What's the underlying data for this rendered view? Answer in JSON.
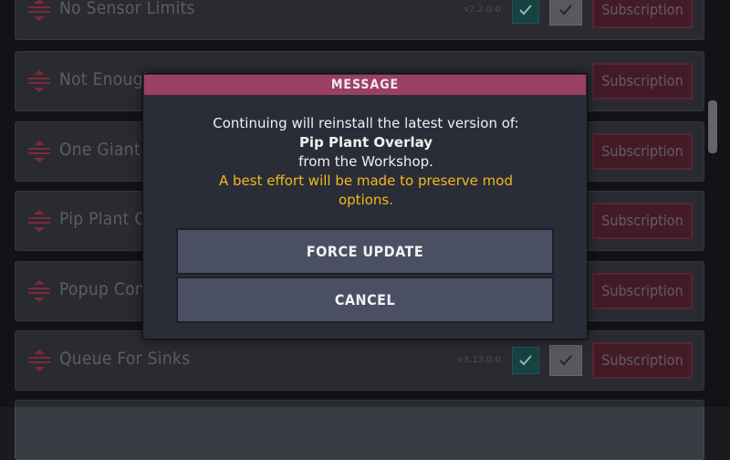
{
  "mods": [
    {
      "name": "No Sensor Limits",
      "version": "v2.2.0.0",
      "subscription_label": "Subscription"
    },
    {
      "name": "Not Enough",
      "version": "",
      "subscription_label": "Subscription"
    },
    {
      "name": "One Giant L",
      "version": "",
      "subscription_label": "Subscription"
    },
    {
      "name": "Pip Plant Ov",
      "version": "",
      "subscription_label": "Subscription"
    },
    {
      "name": "Popup Contr",
      "version": "",
      "subscription_label": "Subscription"
    },
    {
      "name": "Queue For Sinks",
      "version": "v3.13.0.0",
      "subscription_label": "Subscription"
    }
  ],
  "dialog": {
    "title": "MESSAGE",
    "line1": "Continuing will reinstall the latest version of:",
    "mod_name": "Pip Plant Overlay",
    "line3": "from the Workshop.",
    "warning_line1": "A best effort will be made to preserve mod",
    "warning_line2": "options.",
    "force_update_label": "FORCE UPDATE",
    "cancel_label": "CANCEL"
  },
  "colors": {
    "accent": "#9b4065",
    "warning": "#f2b81c",
    "subscription_bg": "#5d2637",
    "check_enabled": "#1f5c5e"
  },
  "icons": {
    "drag": "drag-handle-icon",
    "check": "checkmark-icon"
  }
}
